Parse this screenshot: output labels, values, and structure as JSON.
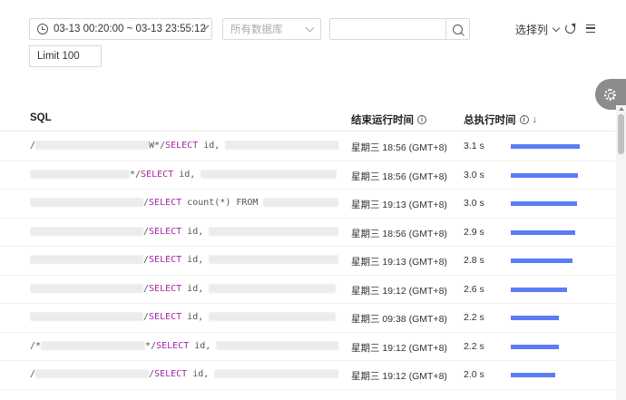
{
  "filters": {
    "time_range": "03-13 00:20:00 ~ 03-13 23:55:12",
    "database_placeholder": "所有数据库",
    "search_value": "",
    "limit": "Limit 100",
    "columns_label": "选择列"
  },
  "table": {
    "headers": {
      "sql": "SQL",
      "end_time": "结束运行时间",
      "total_time": "总执行时间"
    },
    "rows": [
      {
        "sql_prefix": "/",
        "sql_comment": "W*/",
        "sql_kw": "SELECT",
        "sql_rest": " id,",
        "more": "",
        "end_time": "星期三 18:56 (GMT+8)",
        "duration": "3.1 s",
        "ratio": 1.0
      },
      {
        "sql_prefix": "",
        "sql_comment": "*/",
        "sql_kw": "SELECT",
        "sql_rest": " id,",
        "more": "",
        "end_time": "星期三 18:56 (GMT+8)",
        "duration": "3.0 s",
        "ratio": 0.97
      },
      {
        "sql_prefix": "",
        "sql_comment": "/",
        "sql_kw": "SELECT",
        "sql_rest": " count(*) FROM",
        "more": "",
        "end_time": "星期三 19:13 (GMT+8)",
        "duration": "3.0 s",
        "ratio": 0.96
      },
      {
        "sql_prefix": "",
        "sql_comment": "/",
        "sql_kw": "SELECT",
        "sql_rest": " id,",
        "more": "",
        "end_time": "星期三 18:56 (GMT+8)",
        "duration": "2.9 s",
        "ratio": 0.93
      },
      {
        "sql_prefix": "",
        "sql_comment": "/",
        "sql_kw": "SELECT",
        "sql_rest": " id,",
        "more": "",
        "end_time": "星期三 19:13 (GMT+8)",
        "duration": "2.8 s",
        "ratio": 0.89
      },
      {
        "sql_prefix": "",
        "sql_comment": "/",
        "sql_kw": "SELECT",
        "sql_rest": " id,",
        "more": "...",
        "end_time": "星期三 19:12 (GMT+8)",
        "duration": "2.6 s",
        "ratio": 0.82
      },
      {
        "sql_prefix": "",
        "sql_comment": "/",
        "sql_kw": "SELECT",
        "sql_rest": " id,",
        "more": "...",
        "end_time": "星期三 09:38 (GMT+8)",
        "duration": "2.2 s",
        "ratio": 0.7
      },
      {
        "sql_prefix": "/*",
        "sql_comment": "*/",
        "sql_kw": "SELECT",
        "sql_rest": " id,",
        "more": "...",
        "end_time": "星期三 19:12 (GMT+8)",
        "duration": "2.2 s",
        "ratio": 0.7
      },
      {
        "sql_prefix": "/",
        "sql_comment": "/",
        "sql_kw": "SELECT",
        "sql_rest": " id,",
        "more": "), ...",
        "end_time": "星期三 19:12 (GMT+8)",
        "duration": "2.0 s",
        "ratio": 0.65
      }
    ]
  },
  "colors": {
    "bar": "#5b7cf5",
    "keyword": "#a626a4",
    "fab": "#8c8c8c"
  }
}
